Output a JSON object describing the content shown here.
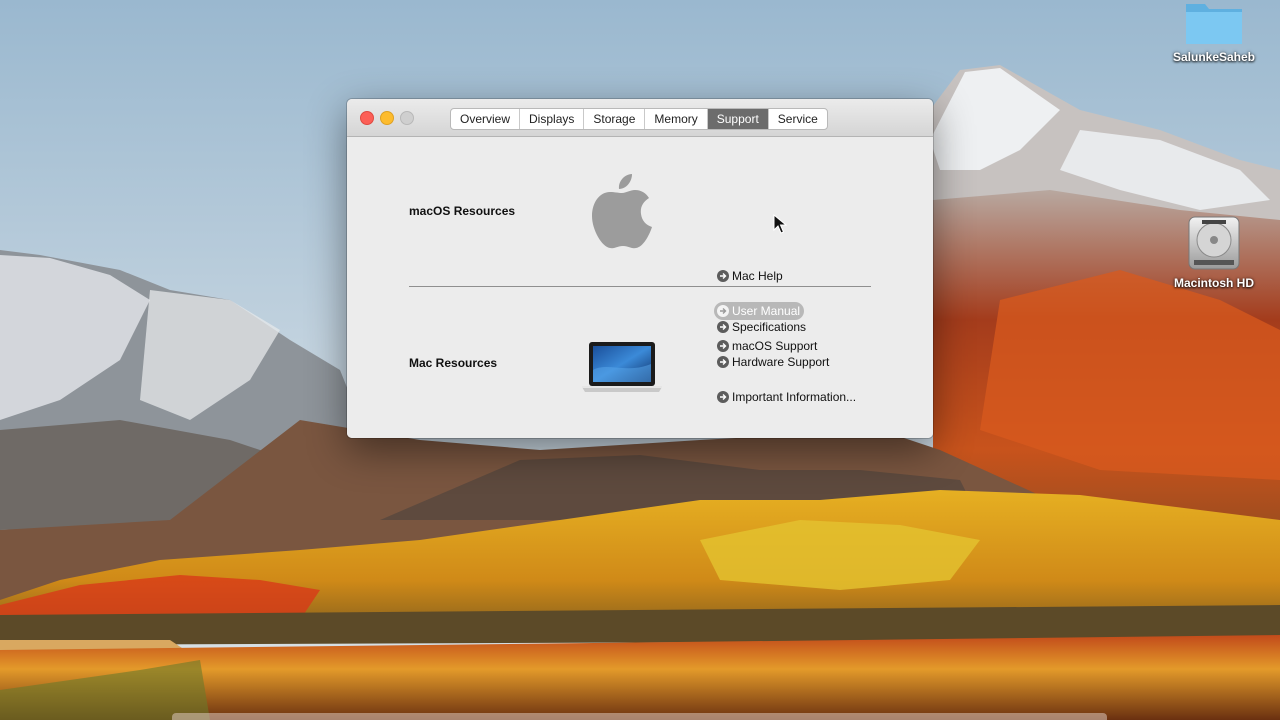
{
  "desktop": {
    "icons": [
      {
        "label": "SalunkeSaheb",
        "icon": "folder-icon"
      },
      {
        "label": "Macintosh HD",
        "icon": "hard-drive-icon"
      }
    ]
  },
  "window": {
    "tabs": [
      {
        "label": "Overview",
        "active": false
      },
      {
        "label": "Displays",
        "active": false
      },
      {
        "label": "Storage",
        "active": false
      },
      {
        "label": "Memory",
        "active": false
      },
      {
        "label": "Support",
        "active": true
      },
      {
        "label": "Service",
        "active": false
      }
    ],
    "macos_resources": {
      "label": "macOS Resources",
      "icon": "apple-logo-icon",
      "links": [
        "Mac Help",
        "User Manual",
        "macOS Support"
      ]
    },
    "mac_resources": {
      "label": "Mac Resources",
      "icon": "laptop-icon",
      "links": [
        "Specifications",
        "Hardware Support",
        "Important Information..."
      ]
    }
  },
  "colors": {
    "active_tab": "#6c6c6c",
    "close": "#fc5f57",
    "minimize": "#fdbc2e",
    "zoom_disabled": "#cfcfcf",
    "link_hover": "#b8b8b8"
  }
}
